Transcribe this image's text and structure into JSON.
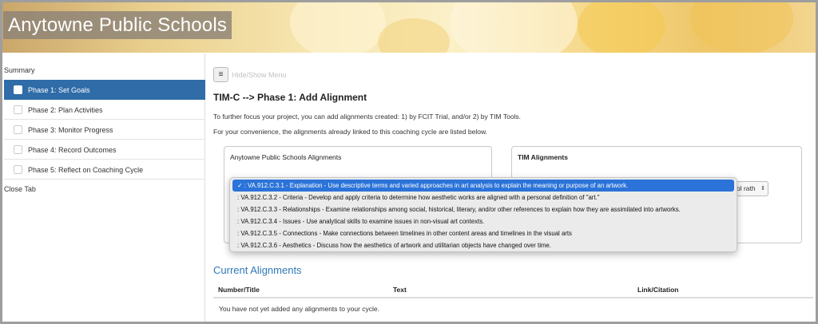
{
  "banner": {
    "title": "Anytowne Public Schools"
  },
  "sidebar": {
    "summary": "Summary",
    "items": [
      {
        "label": "Phase 1: Set Goals",
        "active": true
      },
      {
        "label": "Phase 2: Plan Activities",
        "active": false
      },
      {
        "label": "Phase 3: Monitor Progress",
        "active": false
      },
      {
        "label": "Phase 4: Record Outcomes",
        "active": false
      },
      {
        "label": "Phase 5: Reflect on Coaching Cycle",
        "active": false
      }
    ],
    "close": "Close Tab"
  },
  "main": {
    "menu_icon": "≡",
    "hide_show": "Hide/Show Menu",
    "heading": "TIM-C --> Phase 1: Add Alignment",
    "intro1": "To further focus your project, you can add alignments created: 1) by FCIT Trial, and/or 2) by TIM Tools.",
    "intro2": "For your convenience, the alignments already linked to this coaching cycle are listed below.",
    "left_panel_title": "Anytowne Public Schools Alignments",
    "right_panel_title": "TIM Alignments",
    "right_select_value": "ol rath",
    "dropdown": [
      {
        "text": "✓ : VA.912.C.3.1 - Explanation - Use descriptive terms and varied approaches in art analysis to explain the meaning or purpose of an artwork.",
        "selected": true
      },
      {
        "text": ": VA.912.C.3.2 - Criteria - Develop and apply criteria to determine how aesthetic works are aligned with a personal definition of \"art.\"",
        "selected": false
      },
      {
        "text": ": VA.912.C.3.3 - Relationships - Examine relationships among social, historical, literary, and/or other references to explain how they are assimilated into artworks.",
        "selected": false
      },
      {
        "text": ": VA.912.C.3.4 - Issues - Use analytical skills to examine issues in non-visual art contexts.",
        "selected": false
      },
      {
        "text": ": VA.912.C.3.5 - Connections - Make connections between timelines in other content areas and timelines in the visual arts",
        "selected": false
      },
      {
        "text": ": VA.912.C.3.6 - Aesthetics - Discuss how the aesthetics of artwork and utilitarian objects have changed over time.",
        "selected": false
      }
    ],
    "current_title": "Current Alignments",
    "table_headers": {
      "number": "Number/Title",
      "text": "Text",
      "link": "Link/Citation"
    },
    "empty_message": "You have not yet added any alignments to your cycle."
  },
  "colors": {
    "active": "#2f6ca8",
    "link_blue": "#2f78b7",
    "select_blue": "#2b73d9"
  }
}
